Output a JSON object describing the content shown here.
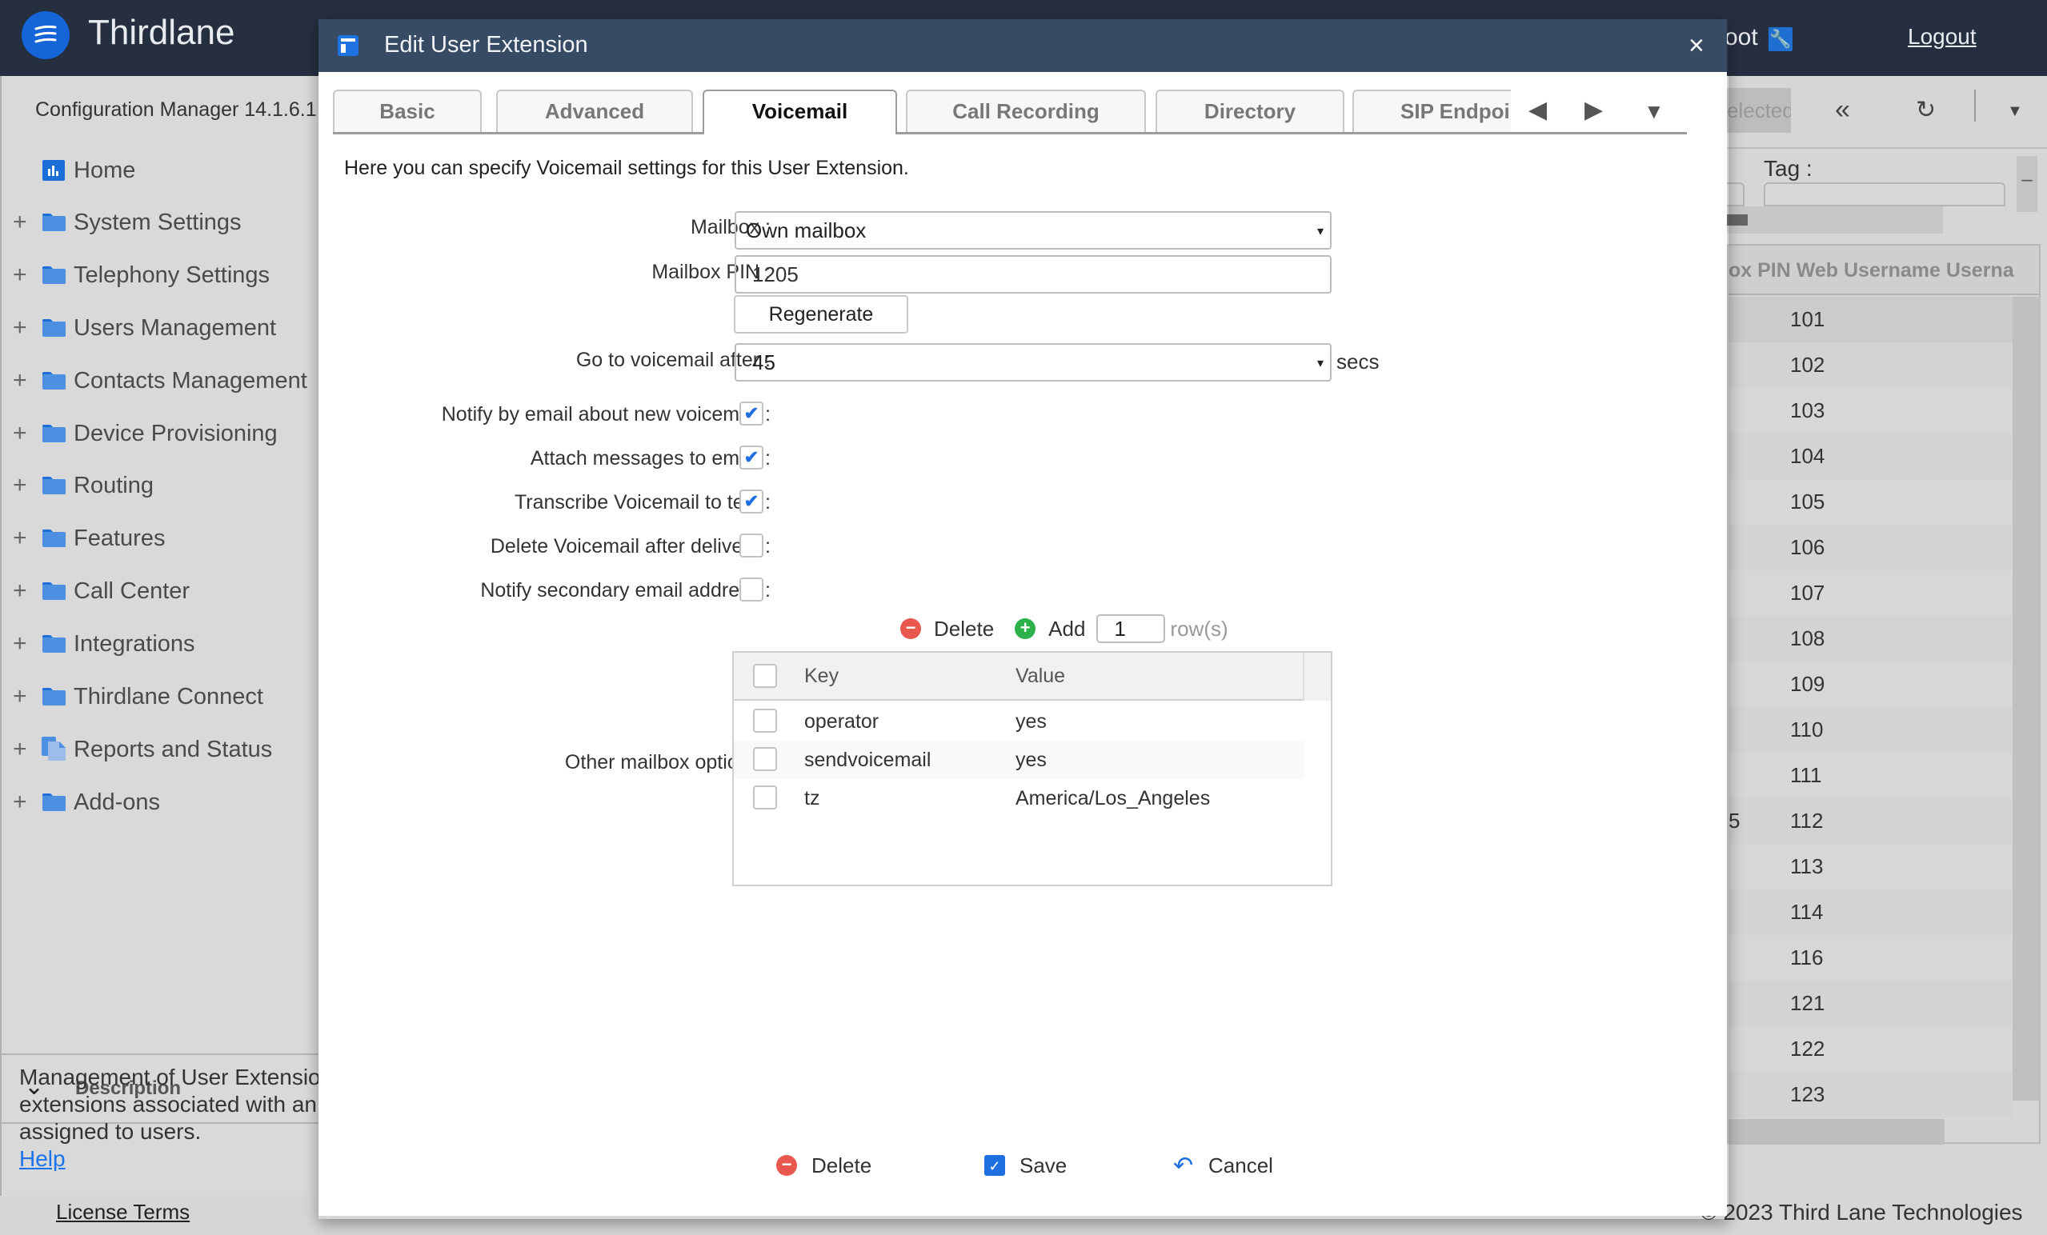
{
  "app": {
    "brand": "Thirdlane",
    "user_partial": "oot",
    "logout": "Logout",
    "config_manager": "Configuration Manager 14.1.6.1",
    "copyright": "© 2023 Third Lane Technologies",
    "license": "License Terms"
  },
  "sidebar": {
    "items": [
      {
        "label": "Home",
        "icon": "home-chart-icon",
        "expandable": false
      },
      {
        "label": "System Settings",
        "icon": "folder-icon",
        "expandable": true
      },
      {
        "label": "Telephony Settings",
        "icon": "folder-icon",
        "expandable": true
      },
      {
        "label": "Users Management",
        "icon": "folder-icon",
        "expandable": true
      },
      {
        "label": "Contacts Management",
        "icon": "folder-icon",
        "expandable": true
      },
      {
        "label": "Device Provisioning",
        "icon": "folder-icon",
        "expandable": true
      },
      {
        "label": "Routing",
        "icon": "folder-icon",
        "expandable": true
      },
      {
        "label": "Features",
        "icon": "folder-icon",
        "expandable": true
      },
      {
        "label": "Call Center",
        "icon": "folder-icon",
        "expandable": true
      },
      {
        "label": "Integrations",
        "icon": "folder-icon",
        "expandable": true
      },
      {
        "label": "Thirdlane Connect",
        "icon": "folder-icon",
        "expandable": true
      },
      {
        "label": "Reports and Status",
        "icon": "documents-icon",
        "expandable": true
      },
      {
        "label": "Add-ons",
        "icon": "folder-icon",
        "expandable": true
      }
    ],
    "plus": "+",
    "description": {
      "title": "Description",
      "lines": [
        "Management of User Extensio",
        "extensions associated with an",
        "assigned to users."
      ],
      "help": "Help"
    }
  },
  "background_grid": {
    "toolbar": {
      "selected_partial": "elected"
    },
    "tag_label": "Tag :",
    "header": "ox PIN Web Username Userna",
    "rows": [
      {
        "pre": "",
        "value": "101"
      },
      {
        "pre": "",
        "value": "102"
      },
      {
        "pre": "",
        "value": "103"
      },
      {
        "pre": "",
        "value": "104"
      },
      {
        "pre": "",
        "value": "105"
      },
      {
        "pre": "",
        "value": "106"
      },
      {
        "pre": "",
        "value": "107"
      },
      {
        "pre": "",
        "value": "108"
      },
      {
        "pre": "",
        "value": "109"
      },
      {
        "pre": "",
        "value": "110"
      },
      {
        "pre": "",
        "value": "111"
      },
      {
        "pre": "5",
        "value": "112"
      },
      {
        "pre": "",
        "value": "113"
      },
      {
        "pre": "",
        "value": "114"
      },
      {
        "pre": "",
        "value": "116"
      },
      {
        "pre": "",
        "value": "121"
      },
      {
        "pre": "",
        "value": "122"
      },
      {
        "pre": "",
        "value": "123"
      }
    ]
  },
  "dialog": {
    "title": "Edit User Extension",
    "close": "×",
    "tabs": [
      {
        "label": "Basic",
        "active": false
      },
      {
        "label": "Advanced",
        "active": false
      },
      {
        "label": "Voicemail",
        "active": true
      },
      {
        "label": "Call Recording",
        "active": false
      },
      {
        "label": "Directory",
        "active": false
      },
      {
        "label": "SIP Endpoints",
        "active": false
      }
    ],
    "intro": "Here you can specify Voicemail settings for this User Extension.",
    "form": {
      "mailbox_label": "Mailbox :",
      "mailbox_value": "Own mailbox",
      "pin_label": "Mailbox PIN :",
      "pin_value": "1205",
      "regenerate": "Regenerate",
      "goto_label": "Go to voicemail after :",
      "goto_value": "45",
      "goto_unit": "secs",
      "checkboxes": [
        {
          "label": "Notify by email about new voicemail :",
          "checked": true
        },
        {
          "label": "Attach messages to email :",
          "checked": true
        },
        {
          "label": "Transcribe Voicemail to text :",
          "checked": true
        },
        {
          "label": "Delete Voicemail after delivery :",
          "checked": false
        },
        {
          "label": "Notify secondary email address :",
          "checked": false
        }
      ],
      "other_label": "Other mailbox options :",
      "kv_toolbar": {
        "delete": "Delete",
        "add": "Add",
        "rows_value": "1",
        "rows_label": "row(s)"
      },
      "kv_columns": [
        "Key",
        "Value"
      ],
      "kv_rows": [
        {
          "key": "operator",
          "value": "yes"
        },
        {
          "key": "sendvoicemail",
          "value": "yes"
        },
        {
          "key": "tz",
          "value": "America/Los_Angeles"
        }
      ]
    },
    "footer": {
      "delete": "Delete",
      "save": "Save",
      "cancel": "Cancel"
    }
  },
  "colors": {
    "topbar": "#262f40",
    "dialog_header": "#374b64",
    "accent": "#1f6fe0",
    "delete_red": "#e8584f",
    "add_green": "#2db14a"
  }
}
